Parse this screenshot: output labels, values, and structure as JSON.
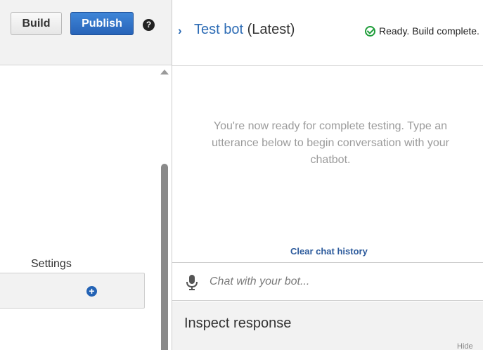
{
  "toolbar": {
    "build_label": "Build",
    "publish_label": "Publish",
    "help_icon": "?"
  },
  "left_panel": {
    "settings_label": "Settings",
    "add_icon": "+"
  },
  "test_panel": {
    "title": "Test bot",
    "version": "(Latest)",
    "status": "Ready. Build complete.",
    "ready_message": "You're now ready for complete testing. Type an utterance below to begin conversation with your chatbot.",
    "clear_history_label": "Clear chat history",
    "chat_placeholder": "Chat with your bot...",
    "inspect_title": "Inspect response",
    "hide_label": "Hide"
  },
  "colors": {
    "accent": "#2d6cb5",
    "publish_bg": "#2763b8",
    "status_ok": "#1f9d3a",
    "panel_bg": "#f2f2f2"
  },
  "icons": [
    "help-icon",
    "chevron-right-icon",
    "check-circle-icon",
    "microphone-icon",
    "add-circle-icon",
    "scroll-up-arrow-icon"
  ]
}
